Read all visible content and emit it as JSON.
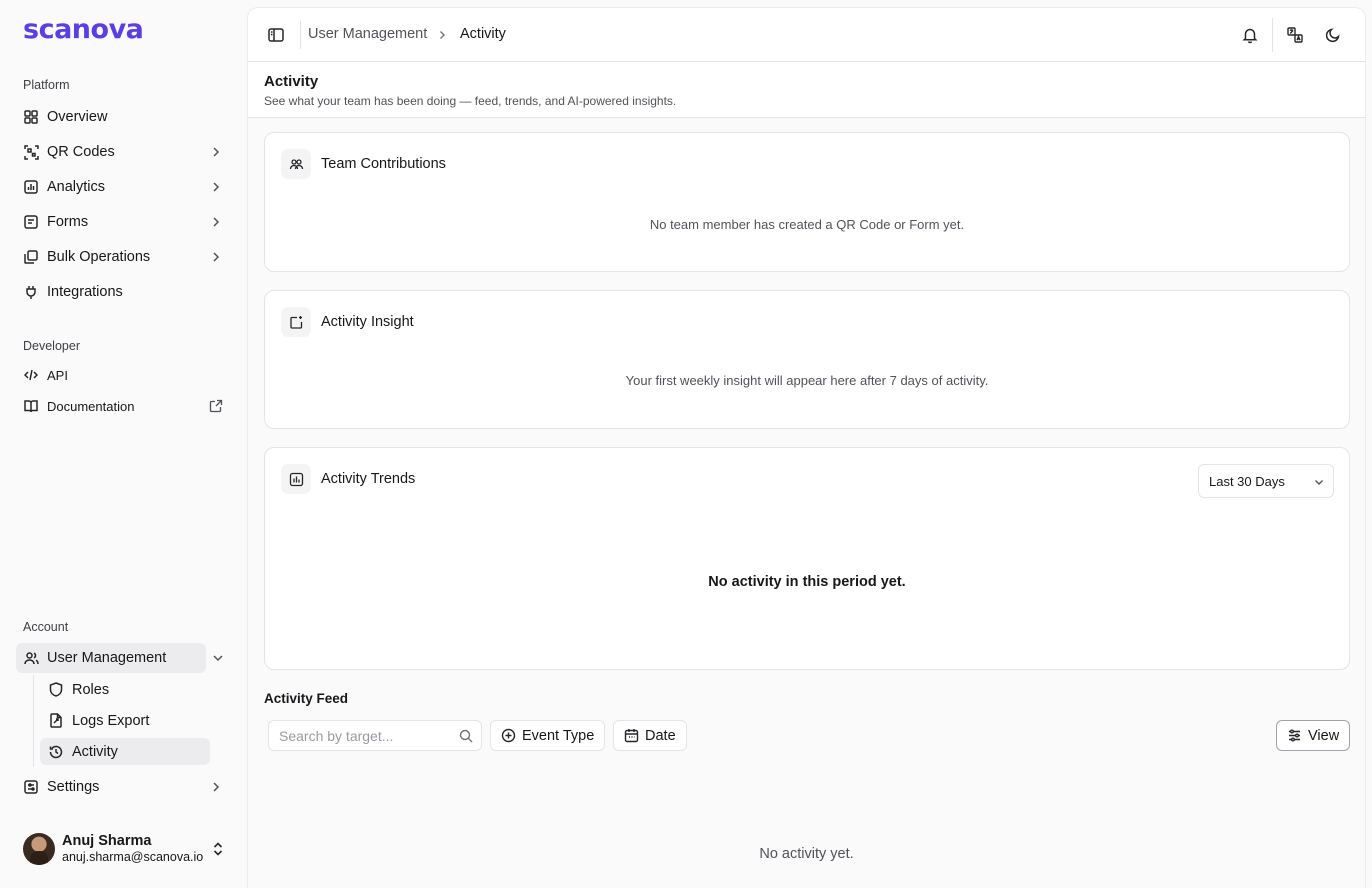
{
  "brand": {
    "logo_text": "scanova"
  },
  "sidebar": {
    "platform_label": "Platform",
    "platform_items": [
      {
        "label": "Overview",
        "icon": "grid-icon"
      },
      {
        "label": "QR Codes",
        "icon": "qr-scan-icon"
      },
      {
        "label": "Analytics",
        "icon": "bar-chart-icon"
      },
      {
        "label": "Forms",
        "icon": "form-icon"
      },
      {
        "label": "Bulk Operations",
        "icon": "layers-icon"
      },
      {
        "label": "Integrations",
        "icon": "plug-icon"
      }
    ],
    "developer_label": "Developer",
    "developer_items": [
      {
        "label": "API",
        "icon": "code-icon"
      },
      {
        "label": "Documentation",
        "icon": "book-icon"
      }
    ],
    "account_label": "Account",
    "user_management": {
      "label": "User Management",
      "icon": "users-icon"
    },
    "user_management_sub": [
      {
        "label": "Roles",
        "icon": "shield-icon"
      },
      {
        "label": "Logs Export",
        "icon": "file-export-icon"
      },
      {
        "label": "Activity",
        "icon": "history-icon"
      }
    ],
    "settings": {
      "label": "Settings",
      "icon": "settings-icon"
    },
    "user": {
      "name": "Anuj Sharma",
      "email": "anuj.sharma@scanova.io"
    }
  },
  "topbar": {
    "breadcrumb": [
      "User Management",
      "Activity"
    ]
  },
  "page": {
    "title": "Activity",
    "subtitle": "See what your team has been doing — feed, trends, and AI-powered insights."
  },
  "cards": {
    "team": {
      "title": "Team Contributions",
      "empty": "No team member has created a QR Code or Form yet."
    },
    "insight": {
      "title": "Activity Insight",
      "empty": "Your first weekly insight will appear here after 7 days of activity."
    },
    "trends": {
      "title": "Activity Trends",
      "range": "Last 30 Days",
      "empty": "No activity in this period yet."
    }
  },
  "feed": {
    "title": "Activity Feed",
    "search_placeholder": "Search by target...",
    "event_type_label": "Event Type",
    "date_label": "Date",
    "view_label": "View",
    "empty": "No activity yet."
  },
  "colors": {
    "brand": "#5b3fe0",
    "border": "#e4e4e7",
    "muted": "#52525b"
  }
}
